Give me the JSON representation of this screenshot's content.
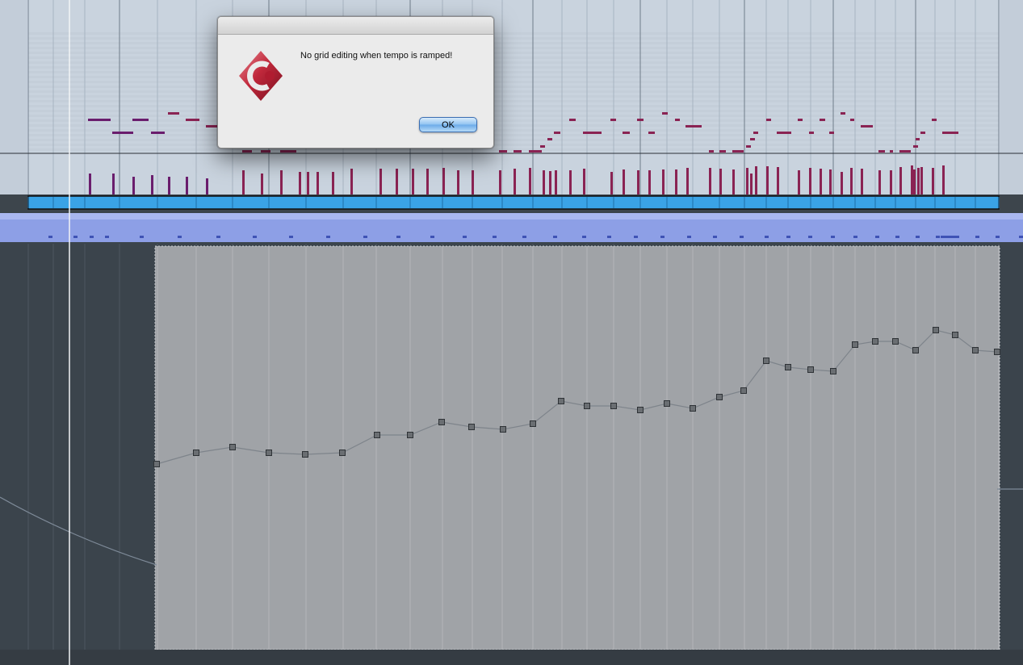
{
  "dialog": {
    "message": "No grid editing when tempo is ramped!",
    "ok_label": "OK",
    "icon": "cubase-logo-icon"
  },
  "tempo_curve": {
    "points": [
      0.46,
      0.488,
      0.502,
      0.488,
      0.484,
      0.488,
      0.532,
      0.532,
      0.564,
      0.552,
      0.546,
      0.56,
      0.616,
      0.604,
      0.604,
      0.594,
      0.61,
      0.598,
      0.626,
      0.642,
      0.716,
      0.7,
      0.694,
      0.69,
      0.756,
      0.764,
      0.764,
      0.742,
      0.792,
      0.78,
      0.742,
      0.738
    ]
  },
  "colors": {
    "grid_area": "#c9d3de",
    "note": "#8a2353",
    "note_purple": "#6a1d6d",
    "event_bar": "#3aa3e6",
    "tempo_lane": "#a0a3a7",
    "tempo_point": "#6a6e72",
    "tempo_line": "#7e848b"
  }
}
